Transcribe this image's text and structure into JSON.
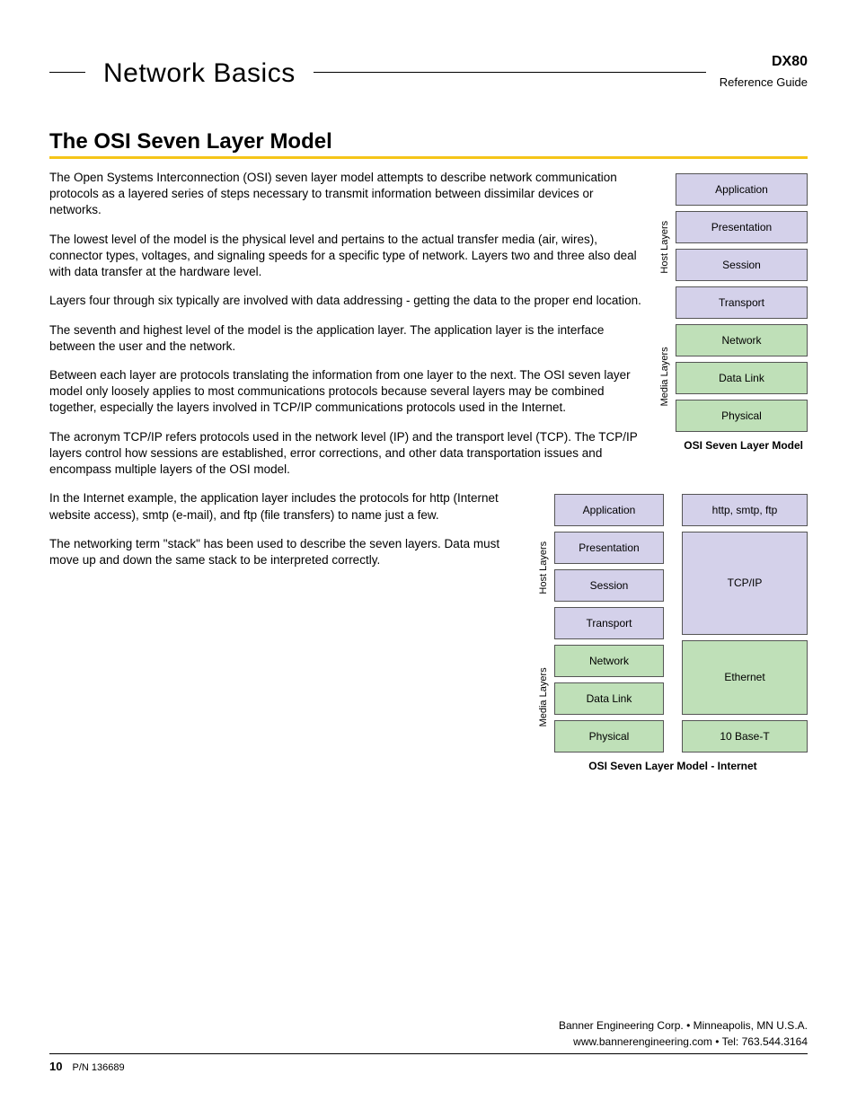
{
  "header": {
    "title": "Network Basics",
    "model": "DX80",
    "ref": "Reference Guide"
  },
  "section_title": "The OSI Seven Layer Model",
  "paragraphs": {
    "p1": "The Open Systems Interconnection (OSI) seven layer model attempts to describe network communication protocols as a layered series of steps necessary to transmit information between dissimilar devices or networks.",
    "p2": "The lowest level of the model is the physical level and pertains to the actual transfer media (air, wires), connector types, voltages, and signaling speeds for a specific type of network. Layers two and three also deal with data transfer at the hardware level.",
    "p3": "Layers four through six typically are involved with data addressing - getting the data to the proper end location.",
    "p4": "The seventh and highest level of the model is the application layer. The application layer is the interface between the user and the network.",
    "p5": "Between each layer are protocols translating the information from one layer to the next. The OSI seven layer model only loosely applies to most communications protocols because several layers may be combined together, especially the layers involved in TCP/IP communications protocols used in the Internet.",
    "p6": "The acronym TCP/IP refers protocols used in the network level (IP) and the transport level (TCP). The TCP/IP layers control how sessions are established, error corrections, and other data transportation issues and encompass multiple layers of the OSI model.",
    "p7": "In the Internet example, the application layer includes the protocols for http (Internet website access), smtp (e-mail), and ftp (file transfers) to name just a few.",
    "p8": "The networking term \"stack\" has been used to describe the seven layers. Data must move up and down the same stack to be interpreted correctly."
  },
  "side_labels": {
    "host": "Host Layers",
    "media": "Media Layers"
  },
  "osi": {
    "application": "Application",
    "presentation": "Presentation",
    "session": "Session",
    "transport": "Transport",
    "network": "Network",
    "datalink": "Data Link",
    "physical": "Physical"
  },
  "internet": {
    "http": "http, smtp, ftp",
    "tcpip": "TCP/IP",
    "ethernet": "Ethernet",
    "tenbase": "10 Base-T"
  },
  "captions": {
    "c1": "OSI Seven Layer Model",
    "c2": "OSI Seven Layer Model - Internet"
  },
  "footer": {
    "line1": "Banner Engineering Corp.  •  Minneapolis, MN U.S.A.",
    "line2": "www.bannerengineering.com  •  Tel: 763.544.3164",
    "page": "10",
    "pn": "P/N 136689"
  }
}
